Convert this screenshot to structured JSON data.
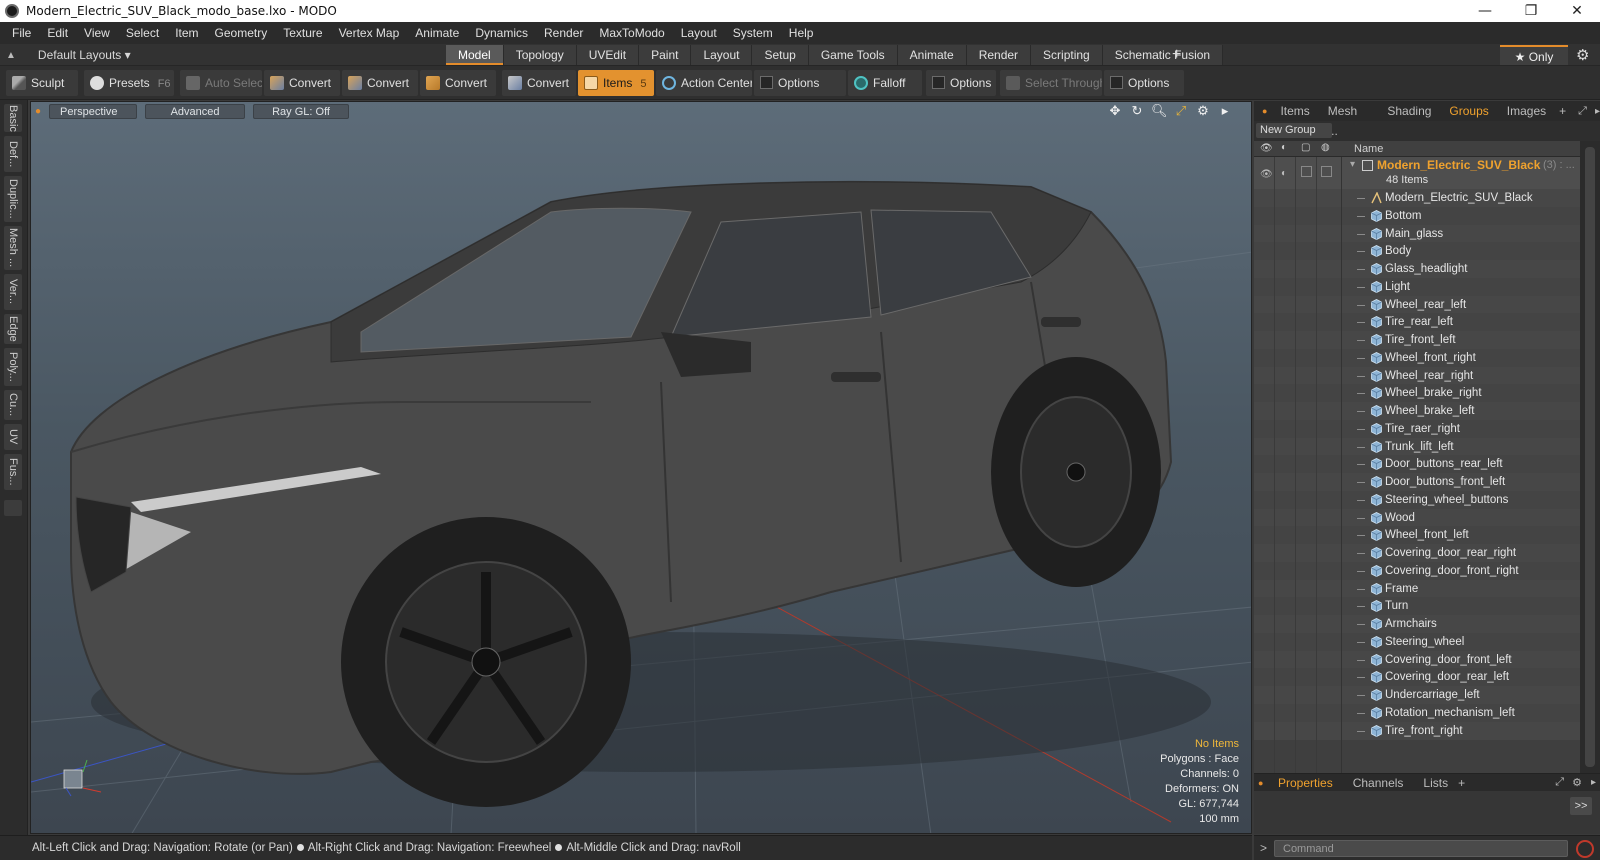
{
  "window": {
    "title": "Modern_Electric_SUV_Black_modo_base.lxo - MODO",
    "controls": [
      "—",
      "❐",
      "✕"
    ]
  },
  "menu": [
    "File",
    "Edit",
    "View",
    "Select",
    "Item",
    "Geometry",
    "Texture",
    "Vertex Map",
    "Animate",
    "Dynamics",
    "Render",
    "MaxToModo",
    "Layout",
    "System",
    "Help"
  ],
  "layoutbar": {
    "layouts_label": "Default Layouts ▾",
    "tabs": [
      "Model",
      "Topology",
      "UVEdit",
      "Paint",
      "Layout",
      "Setup",
      "Game Tools",
      "Animate",
      "Render",
      "Scripting",
      "Schematic Fusion"
    ],
    "active_tab": "Model",
    "plus": "+",
    "only_label": "★  Only",
    "gear": "⚙"
  },
  "toolbar": {
    "sculpt": "Sculpt",
    "presets": "Presets",
    "presets_key": "F6",
    "auto_select": "Auto Select",
    "convert": "Convert",
    "items": "Items",
    "items_key": "5",
    "action_center": "Action Center",
    "options": "Options",
    "falloff": "Falloff",
    "select_through": "Select Through"
  },
  "left_tabs": [
    "Basic",
    "Def...",
    "Duplic...",
    "Mesh ...",
    "Ver...",
    "Edge",
    "Poly...",
    "Cu...",
    "UV",
    "Fus..."
  ],
  "viewport": {
    "view_mode": "Perspective",
    "shading": "Advanced",
    "raygl": "Ray GL: Off",
    "info": {
      "selection": "No Items",
      "polygons": "Polygons : Face",
      "channels": "Channels: 0",
      "deformers": "Deformers: ON",
      "gl": "GL: 677,744",
      "scale": "100 mm"
    }
  },
  "panel": {
    "tabs": [
      "Items",
      "Mesh ...",
      "Shading",
      "Groups",
      "Images"
    ],
    "active_tab": "Groups",
    "new_group": "New Group",
    "name_header": "Name",
    "group_name": "Modern_Electric_SUV_Black",
    "group_count": "(3) : ...",
    "group_items": "48 Items",
    "items": [
      "Modern_Electric_SUV_Black",
      "Bottom",
      "Main_glass",
      "Body",
      "Glass_headlight",
      "Light",
      "Wheel_rear_left",
      "Tire_rear_left",
      "Tire_front_left",
      "Wheel_front_right",
      "Wheel_rear_right",
      "Wheel_brake_right",
      "Wheel_brake_left",
      "Tire_raer_right",
      "Trunk_lift_left",
      "Door_buttons_rear_left",
      "Door_buttons_front_left",
      "Steering_wheel_buttons",
      "Wood",
      "Wheel_front_left",
      "Covering_door_rear_right",
      "Covering_door_front_right",
      "Frame",
      "Turn",
      "Armchairs",
      "Steering_wheel",
      "Covering_door_front_left",
      "Covering_door_rear_left",
      "Undercarriage_left",
      "Rotation_mechanism_left",
      "Tire_front_right"
    ],
    "bottom_tabs": [
      "Properties",
      "Channels",
      "Lists"
    ],
    "bottom_active": "Properties",
    "expand": ">>"
  },
  "status": {
    "hint1": "Alt-Left Click and Drag: Navigation: Rotate (or Pan)",
    "hint2": "Alt-Right Click and Drag: Navigation: Freewheel",
    "hint3": "Alt-Middle Click and Drag: navRoll"
  },
  "command": {
    "prompt": ">",
    "placeholder": "Command"
  },
  "colors": {
    "accent": "#e3922f",
    "viewport_top": "#5d6c79",
    "viewport_bottom": "#3d4650",
    "car_body": "#4a4a4a"
  }
}
